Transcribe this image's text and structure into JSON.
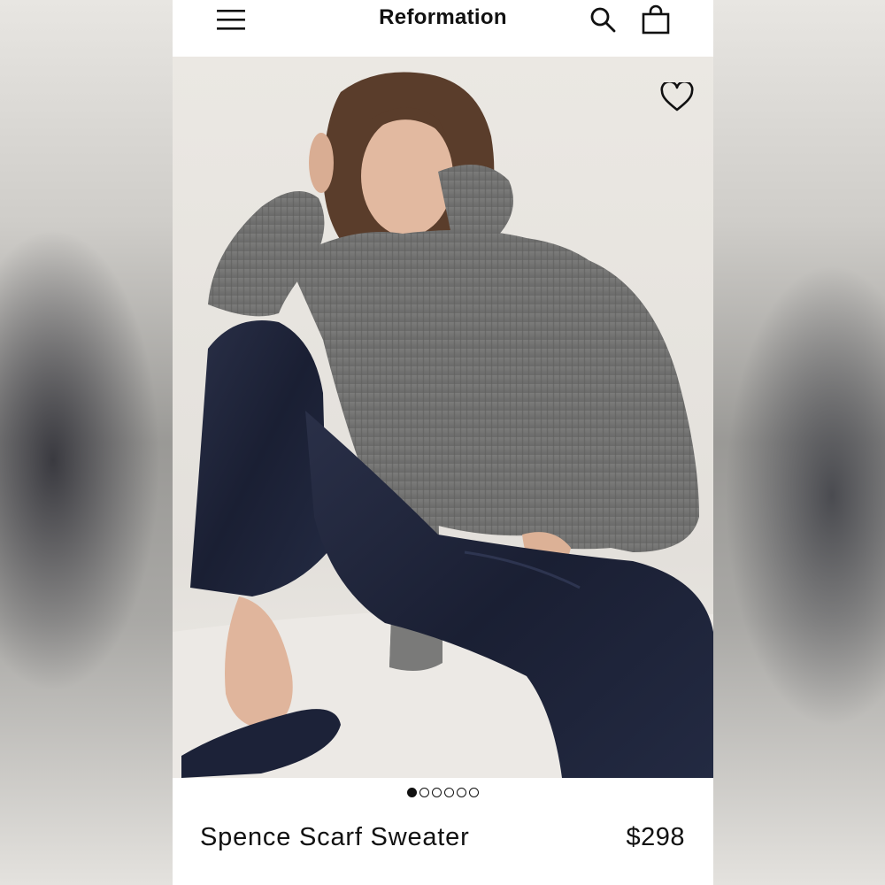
{
  "header": {
    "brand": "Reformation",
    "menu_icon": "hamburger-menu-icon",
    "search_icon": "search-icon",
    "bag_icon": "shopping-bag-icon"
  },
  "product": {
    "image_alt": "Model wearing grey knit scarf sweater and navy satin pants",
    "wishlist_icon": "heart-outline-icon",
    "name": "Spence Scarf Sweater",
    "price": "$298"
  },
  "carousel": {
    "total": 6,
    "active_index": 0
  },
  "colors": {
    "sweater": "#737373",
    "pants": "#1e2438",
    "backdrop": "#e6e3de",
    "text": "#111111"
  }
}
